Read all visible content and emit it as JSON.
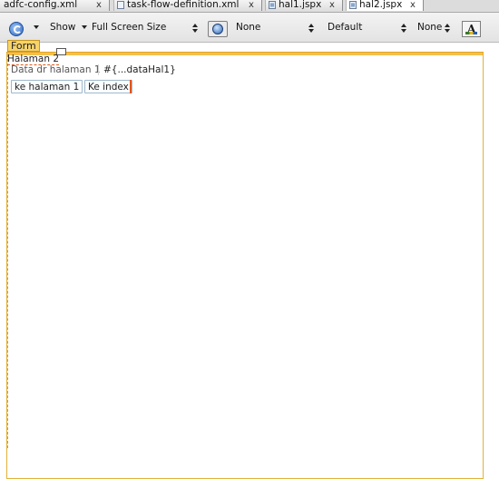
{
  "tabs": [
    {
      "label": "adfc-config.xml",
      "close": "x",
      "active": false
    },
    {
      "label": "task-flow-definition.xml",
      "close": "x",
      "active": false
    },
    {
      "label": "hal1.jspx",
      "close": "x",
      "active": false
    },
    {
      "label": "hal2.jspx",
      "close": "x",
      "active": true
    }
  ],
  "toolbar": {
    "show_label": "Show",
    "screen_size": "Full Screen Size",
    "browser_option": "None",
    "skin_option": "Default",
    "right_option": "None",
    "icons": {
      "refresh": "refresh-icon",
      "browser": "globe-icon",
      "format": "text-format-icon"
    }
  },
  "design": {
    "form_tag": "Form",
    "page_title": "Halaman 2",
    "output_label": "Data dr halaman 1",
    "output_value": "#{...dataHal1}",
    "buttons": {
      "to_page1": "ke halaman 1",
      "to_index": "Ke index"
    },
    "colors": {
      "outline": "#e2b13a",
      "form_tag": "#f7d36a",
      "button_border": "#9fb8cc",
      "caret": "#e2561c"
    }
  }
}
